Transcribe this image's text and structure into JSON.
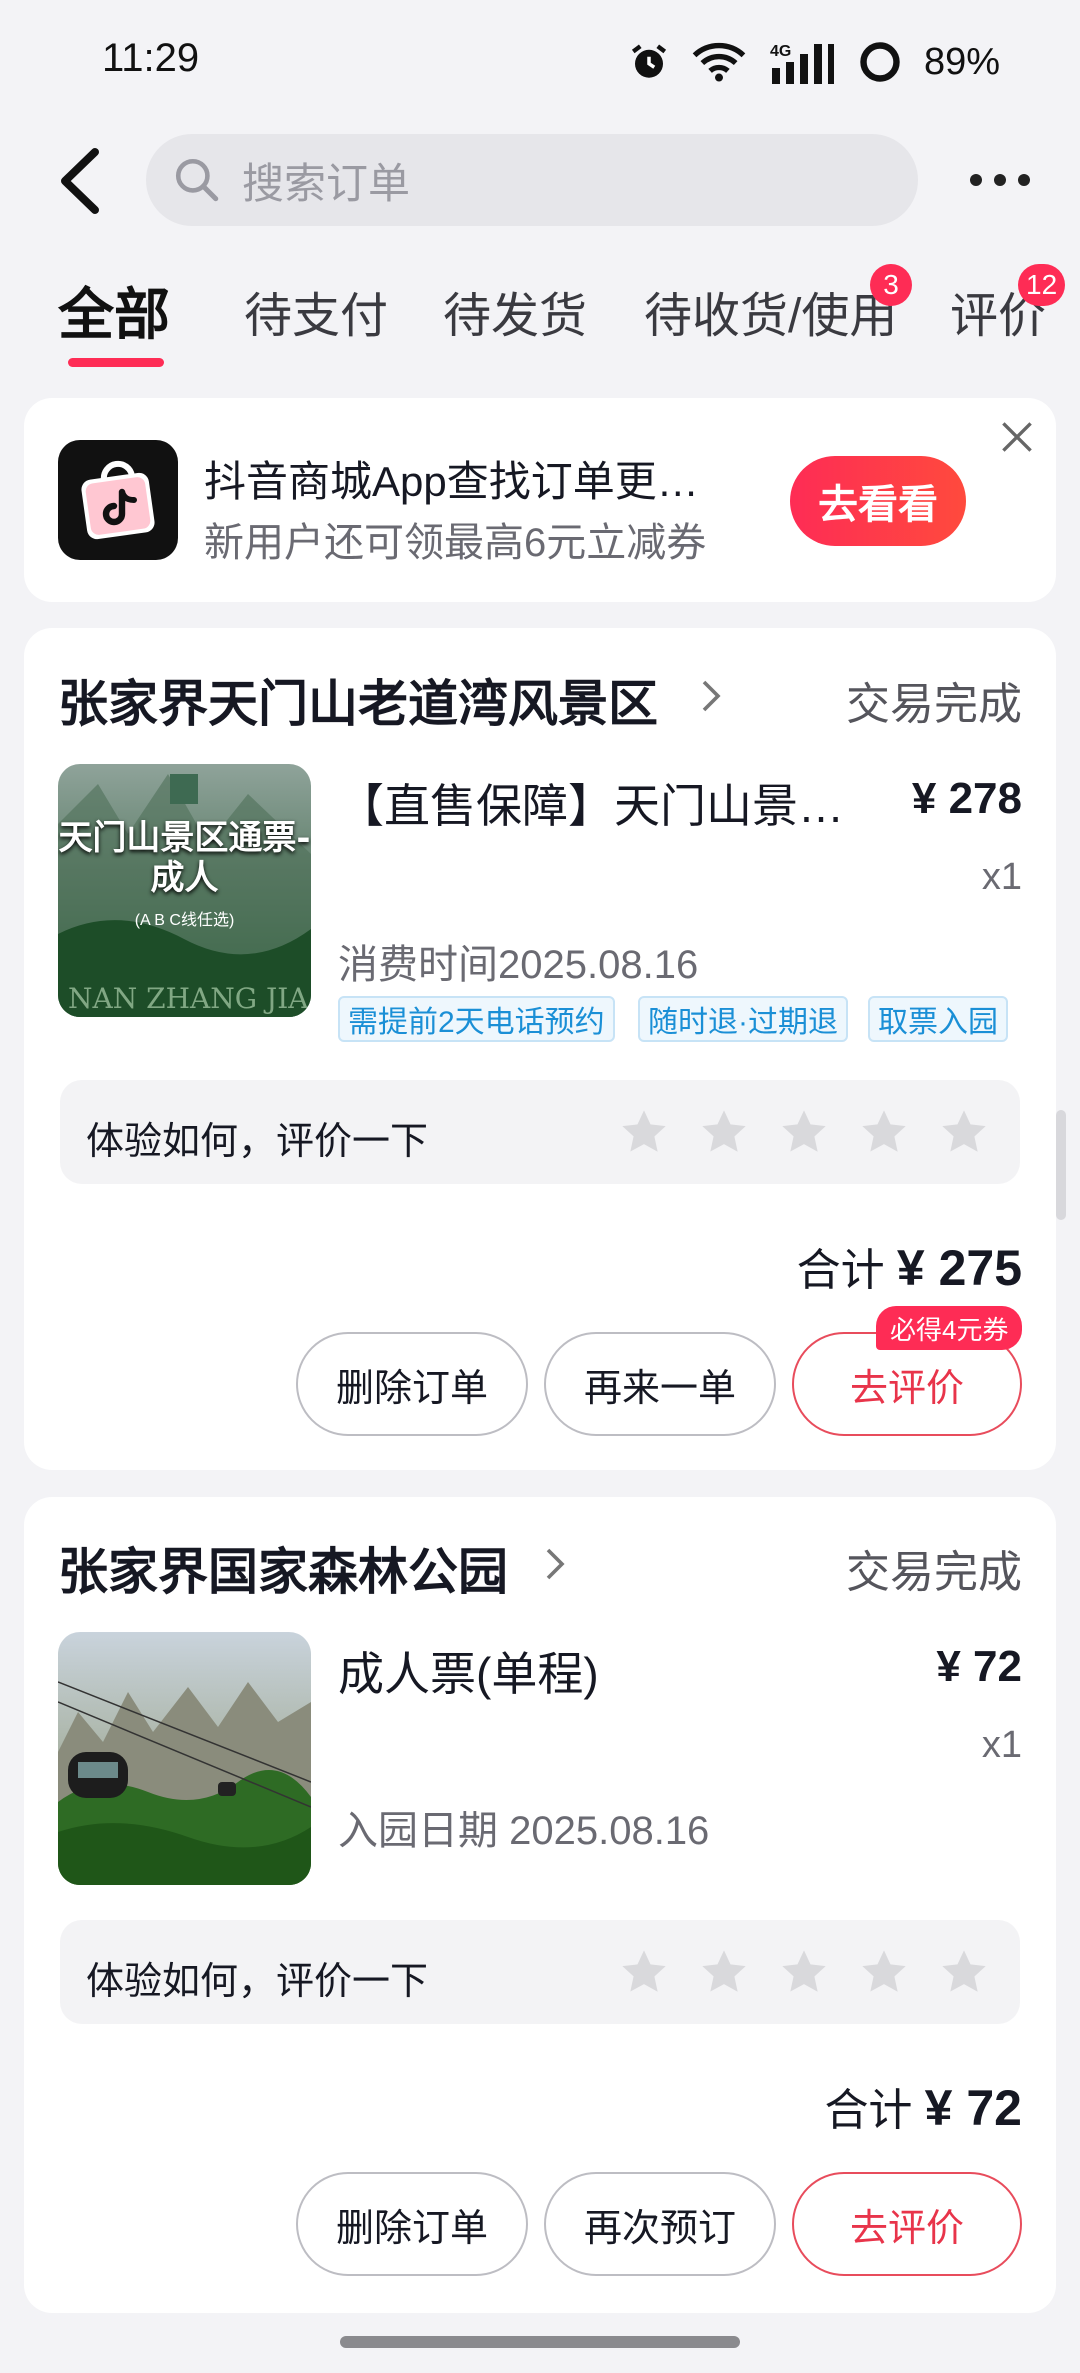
{
  "status_bar": {
    "time": "11:29",
    "battery": "89%"
  },
  "header": {
    "search_placeholder": "搜索订单"
  },
  "tabs": [
    {
      "label": "全部",
      "badge": ""
    },
    {
      "label": "待支付",
      "badge": ""
    },
    {
      "label": "待发货",
      "badge": ""
    },
    {
      "label": "待收货/使用",
      "badge": "3"
    },
    {
      "label": "评价",
      "badge": "12"
    }
  ],
  "promo": {
    "title": "抖音商城App查找订单更…",
    "subtitle": "新用户还可领最高6元立减券",
    "button": "去看看"
  },
  "orders": [
    {
      "shop": "张家界天门山老道湾风景区",
      "status": "交易完成",
      "thumb_text": "天门山景区通票-成人",
      "thumb_sub": "(A B C线任选)",
      "thumb_footer": "NAN ZHANG JIA",
      "item_title": "【直售保障】天门山景…",
      "price": "¥ 278",
      "qty": "x1",
      "meta": "消费时间2025.08.16",
      "tags": [
        "需提前2天电话预约",
        "随时退·过期退",
        "取票入园"
      ],
      "review_prompt": "体验如何，评价一下",
      "total_label": "合计",
      "total": "¥ 275",
      "buttons": [
        "删除订单",
        "再来一单",
        "去评价"
      ],
      "coupon": "必得4元券"
    },
    {
      "shop": "张家界国家森林公园",
      "status": "交易完成",
      "item_title": "成人票(单程)",
      "price": "¥ 72",
      "qty": "x1",
      "meta": "入园日期 2025.08.16",
      "review_prompt": "体验如何，评价一下",
      "total_label": "合计",
      "total": "¥ 72",
      "buttons": [
        "删除订单",
        "再次预订",
        "去评价"
      ]
    }
  ],
  "colors": {
    "accent": "#fe2c55",
    "tag_blue": "#1a8fd6"
  }
}
